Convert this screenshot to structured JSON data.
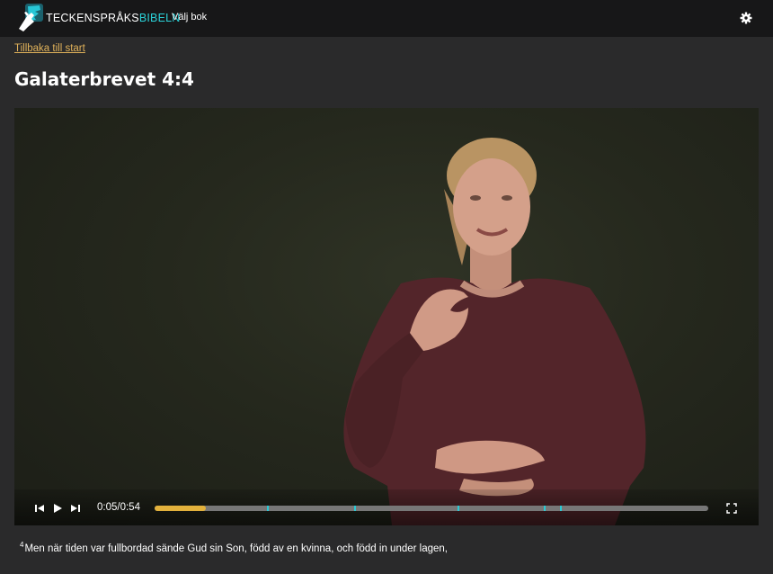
{
  "header": {
    "brand_part1": "TECKENSPRÅKS",
    "brand_part2": "BIBELN",
    "choose_book": "Välj bok",
    "logo_icon": "hand-sign-logo-icon",
    "settings_icon": "gear-icon",
    "accent_color": "#2bd1d7"
  },
  "nav": {
    "back_link": "Tillbaka till start",
    "link_color": "#e1b25a"
  },
  "page": {
    "title": "Galaterbrevet 4:4"
  },
  "player": {
    "time_display": "0:05/0:54",
    "current_seconds": 5,
    "duration_seconds": 54,
    "progress_color": "#e2b13c",
    "chapter_markers_seconds": [
      11,
      19.5,
      29.5,
      38,
      39.5
    ],
    "marker_color": "#2bc9d4",
    "icons": [
      "skip-back-icon",
      "play-icon",
      "skip-forward-icon",
      "fullscreen-icon"
    ]
  },
  "verse": {
    "number": "4",
    "text": "Men när tiden var fullbordad sände Gud sin Son, född av en kvinna, och född in under lagen,"
  }
}
